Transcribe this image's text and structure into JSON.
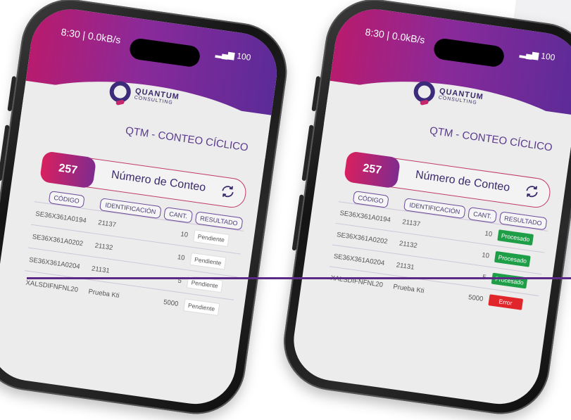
{
  "status_bar": {
    "time": "8:30 | 0.0kB/s",
    "battery": "100"
  },
  "brand": {
    "line1": "QUANTUM",
    "line2": "CONSULTING"
  },
  "page_title": "QTM - CONTEO CÍCLICO",
  "counter": {
    "value": "257",
    "label": "Número de Conteo"
  },
  "table": {
    "headers": [
      "CÓDIGO",
      "IDENTIFICACIÓN",
      "CANT.",
      "RESULTADO"
    ]
  },
  "phones": [
    {
      "rows": [
        {
          "code": "SE36X361A0194",
          "id": "21137",
          "qty": "10",
          "result": "Pendiente"
        },
        {
          "code": "SE36X361A0202",
          "id": "21132",
          "qty": "10",
          "result": "Pendiente"
        },
        {
          "code": "SE36X361A0204",
          "id": "21131",
          "qty": "5",
          "result": "Pendiente"
        },
        {
          "code": "XALSDIFNFNL20",
          "id": "Prueba Kti",
          "qty": "5000",
          "result": "Pendiente"
        }
      ]
    },
    {
      "rows": [
        {
          "code": "SE36X361A0194",
          "id": "21137",
          "qty": "10",
          "result": "Procesado"
        },
        {
          "code": "SE36X361A0202",
          "id": "21132",
          "qty": "10",
          "result": "Procesado"
        },
        {
          "code": "SE36X361A0204",
          "id": "21131",
          "qty": "5",
          "result": "Procesado"
        },
        {
          "code": "XALSDIFNFNL20",
          "id": "Prueba Kti",
          "qty": "5000",
          "result": "Error"
        }
      ]
    }
  ],
  "colors": {
    "header_start": "#b81b6e",
    "header_end": "#5b2b98",
    "processed": "#1f9e48",
    "error": "#e0262b"
  }
}
